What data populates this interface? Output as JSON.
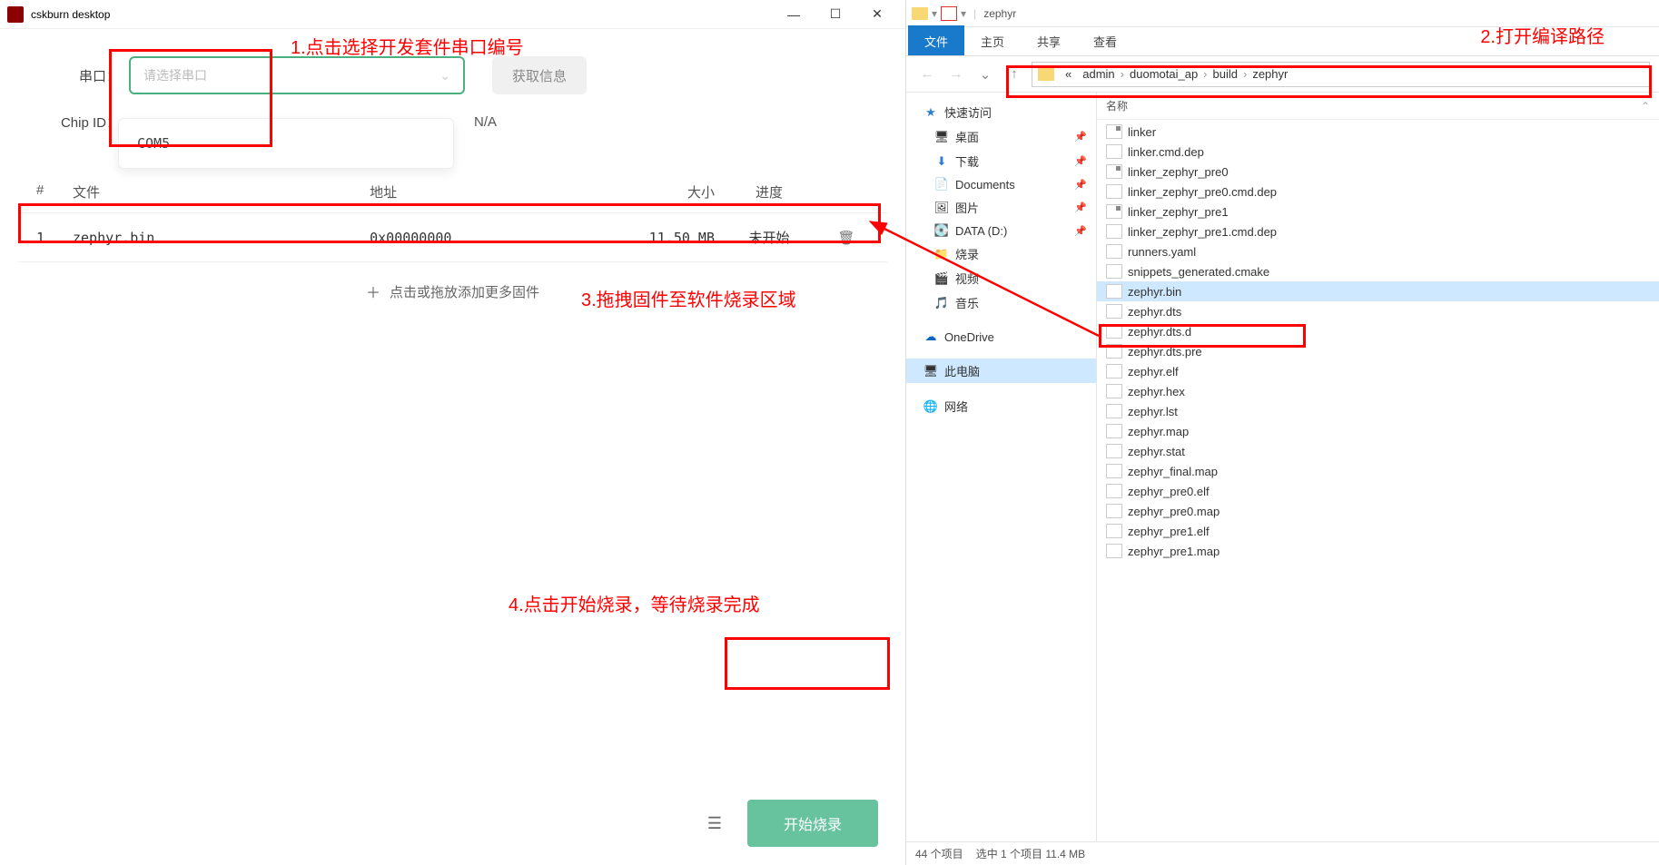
{
  "cskburn": {
    "window_title": "cskburn desktop",
    "serial_label": "串口：",
    "serial_placeholder": "请选择串口",
    "get_info_btn": "获取信息",
    "chip_id_label": "Chip ID：",
    "chip_id_value": "N/A",
    "serial_options": [
      "COM5"
    ],
    "table": {
      "headers": {
        "num": "#",
        "file": "文件",
        "addr": "地址",
        "size": "大小",
        "prog": "进度"
      },
      "rows": [
        {
          "num": "1",
          "file": "zephyr.bin",
          "addr": "0x00000000",
          "size": "11.50 MB",
          "prog": "未开始"
        }
      ],
      "add_hint": "点击或拖放添加更多固件"
    },
    "start_btn": "开始烧录"
  },
  "annotations": {
    "a1": "1.点击选择开发套件串口编号",
    "a2": "2.打开编译路径",
    "a3": "3.拖拽固件至软件烧录区域",
    "a4": "4.点击开始烧录，等待烧录完成"
  },
  "explorer": {
    "qat_title": "zephyr",
    "tabs": {
      "file": "文件",
      "home": "主页",
      "share": "共享",
      "view": "查看"
    },
    "breadcrumb": [
      "«",
      "admin",
      "duomotai_ap",
      "build",
      "zephyr"
    ],
    "nav_pane": {
      "quick_access": "快速访问",
      "items_pinned": [
        {
          "label": "桌面",
          "icon": "🖥",
          "pin": true
        },
        {
          "label": "下载",
          "icon": "⬇",
          "pin": true
        },
        {
          "label": "Documents",
          "icon": "📄",
          "pin": true
        },
        {
          "label": "图片",
          "icon": "🖼",
          "pin": true
        },
        {
          "label": "DATA (D:)",
          "icon": "💽",
          "pin": true
        }
      ],
      "items_unpinned": [
        {
          "label": "烧录",
          "icon": "📁"
        },
        {
          "label": "视频",
          "icon": "🎬"
        },
        {
          "label": "音乐",
          "icon": "🎵"
        }
      ],
      "onedrive": "OneDrive",
      "this_pc": "此电脑",
      "network": "网络",
      "this_pc_selected": true
    },
    "columns": {
      "name": "名称"
    },
    "files": [
      {
        "name": "linker",
        "type": "script"
      },
      {
        "name": "linker.cmd.dep",
        "type": "file"
      },
      {
        "name": "linker_zephyr_pre0",
        "type": "script"
      },
      {
        "name": "linker_zephyr_pre0.cmd.dep",
        "type": "file"
      },
      {
        "name": "linker_zephyr_pre1",
        "type": "script"
      },
      {
        "name": "linker_zephyr_pre1.cmd.dep",
        "type": "file"
      },
      {
        "name": "runners.yaml",
        "type": "file"
      },
      {
        "name": "snippets_generated.cmake",
        "type": "file"
      },
      {
        "name": "zephyr.bin",
        "type": "file",
        "selected": true
      },
      {
        "name": "zephyr.dts",
        "type": "file"
      },
      {
        "name": "zephyr.dts.d",
        "type": "file"
      },
      {
        "name": "zephyr.dts.pre",
        "type": "file"
      },
      {
        "name": "zephyr.elf",
        "type": "file"
      },
      {
        "name": "zephyr.hex",
        "type": "file"
      },
      {
        "name": "zephyr.lst",
        "type": "file"
      },
      {
        "name": "zephyr.map",
        "type": "file"
      },
      {
        "name": "zephyr.stat",
        "type": "file"
      },
      {
        "name": "zephyr_final.map",
        "type": "file"
      },
      {
        "name": "zephyr_pre0.elf",
        "type": "file"
      },
      {
        "name": "zephyr_pre0.map",
        "type": "file"
      },
      {
        "name": "zephyr_pre1.elf",
        "type": "file"
      },
      {
        "name": "zephyr_pre1.map",
        "type": "file"
      }
    ],
    "status": {
      "total": "44 个项目",
      "selected": "选中 1 个项目 11.4 MB"
    }
  }
}
